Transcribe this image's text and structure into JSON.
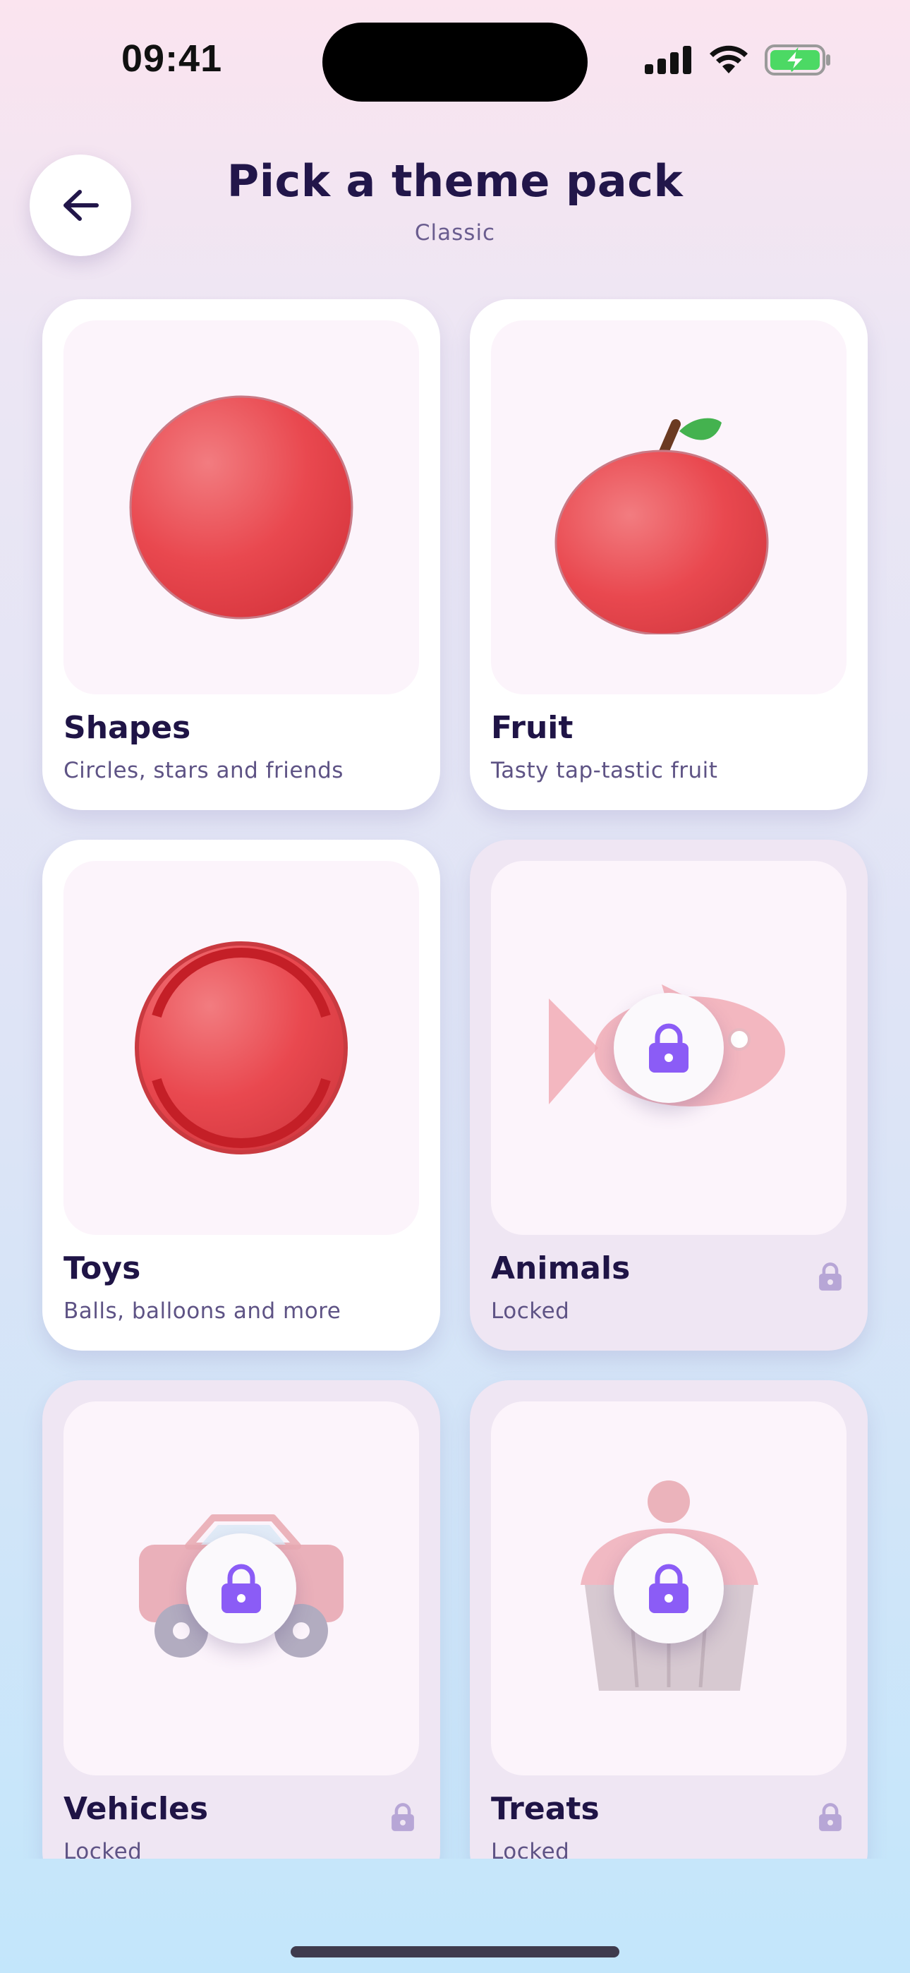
{
  "status_bar": {
    "time": "09:41"
  },
  "header": {
    "title": "Pick a theme pack",
    "subtitle": "Classic"
  },
  "packs": [
    {
      "title": "Shapes",
      "description": "Circles, stars and friends",
      "locked": false,
      "icon": "red-circle"
    },
    {
      "title": "Fruit",
      "description": "Tasty tap-tastic fruit",
      "locked": false,
      "icon": "apple"
    },
    {
      "title": "Toys",
      "description": "Balls, balloons and more",
      "locked": false,
      "icon": "ball"
    },
    {
      "title": "Animals",
      "description": "Locked",
      "locked": true,
      "icon": "fish"
    },
    {
      "title": "Vehicles",
      "description": "Locked",
      "locked": true,
      "icon": "car"
    },
    {
      "title": "Treats",
      "description": "Locked",
      "locked": true,
      "icon": "cupcake"
    }
  ],
  "colors": {
    "accent": "#8b5cf6",
    "title": "#22164a",
    "red": "#e9424a"
  }
}
